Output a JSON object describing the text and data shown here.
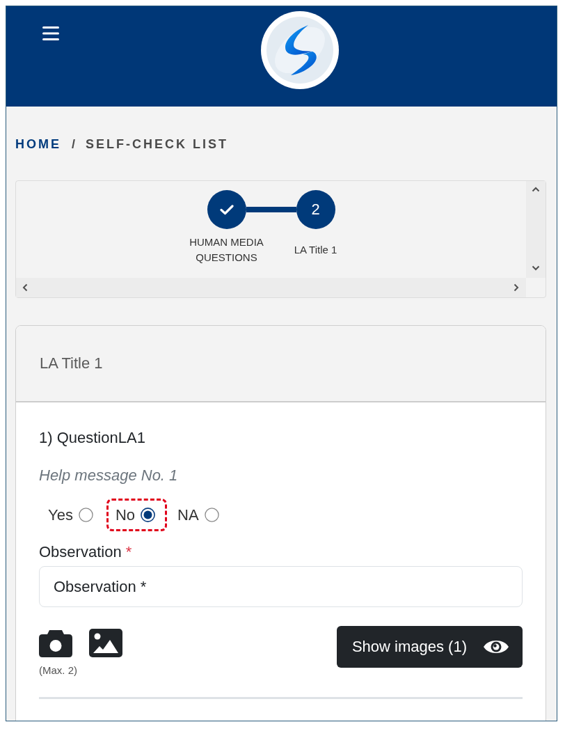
{
  "breadcrumb": {
    "separator": "/",
    "items": [
      {
        "label": "HOME",
        "current": false
      },
      {
        "label": "SELF-CHECK LIST",
        "current": true
      }
    ]
  },
  "stepper": {
    "steps": [
      {
        "label": "HUMAN MEDIA QUESTIONS",
        "completed": true
      },
      {
        "label": "LA Title 1",
        "number": "2",
        "completed": false
      }
    ]
  },
  "card": {
    "title": "LA Title 1",
    "question": {
      "text": "1) QuestionLA1",
      "help": "Help message No. 1",
      "options": [
        {
          "label": "Yes",
          "selected": false,
          "highlighted": false
        },
        {
          "label": "No",
          "selected": true,
          "highlighted": true
        },
        {
          "label": "NA",
          "selected": false,
          "highlighted": false
        }
      ],
      "observation": {
        "label": "Observation",
        "required_mark": "*",
        "placeholder": "Observation *"
      },
      "attachment_note": "(Max. 2)",
      "show_images_button": "Show images (1)"
    }
  }
}
